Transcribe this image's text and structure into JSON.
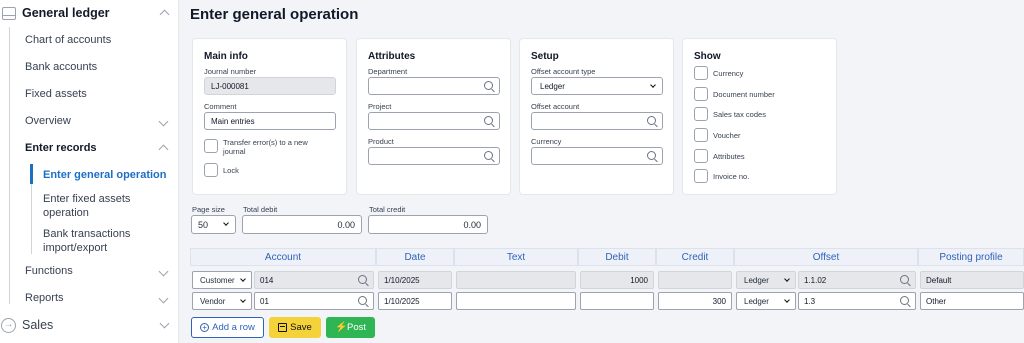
{
  "sidebar": {
    "general_ledger": "General ledger",
    "items": {
      "chart": "Chart of accounts",
      "bank": "Bank accounts",
      "fixed": "Fixed assets",
      "overview": "Overview",
      "enter_records": "Enter records",
      "functions": "Functions",
      "reports": "Reports"
    },
    "sub": {
      "general_op": "Enter general operation",
      "fixed_assets_op": "Enter fixed assets operation",
      "bank_tx": "Bank transactions import/export"
    },
    "sales": "Sales"
  },
  "page": {
    "title": "Enter general operation"
  },
  "main_info": {
    "title": "Main info",
    "journal_label": "Journal number",
    "journal_value": "LJ-000081",
    "comment_label": "Comment",
    "comment_value": "Main entries",
    "transfer_label": "Transfer error(s) to a new journal",
    "lock_label": "Lock"
  },
  "attributes": {
    "title": "Attributes",
    "department_label": "Department",
    "project_label": "Project",
    "product_label": "Product"
  },
  "setup": {
    "title": "Setup",
    "offset_type_label": "Offset account type",
    "offset_type_value": "Ledger",
    "offset_account_label": "Offset account",
    "currency_label": "Currency"
  },
  "show": {
    "title": "Show",
    "options": [
      "Currency",
      "Document number",
      "Sales tax codes",
      "Voucher",
      "Attributes",
      "Invoice no."
    ]
  },
  "totals": {
    "page_size_label": "Page size",
    "page_size_value": "50",
    "total_debit_label": "Total debit",
    "total_debit_value": "0.00",
    "total_credit_label": "Total credit",
    "total_credit_value": "0.00"
  },
  "grid": {
    "headers": {
      "account": "Account",
      "date": "Date",
      "text": "Text",
      "debit": "Debit",
      "credit": "Credit",
      "offset": "Offset",
      "posting_profile": "Posting profile"
    },
    "rows": [
      {
        "type": "Customer",
        "account": "014",
        "date": "1/10/2025",
        "text": "",
        "debit": "1000",
        "credit": "",
        "offset_type": "Ledger",
        "offset": "1.1.02",
        "profile": "Default"
      },
      {
        "type": "Vendor",
        "account": "01",
        "date": "1/10/2025",
        "text": "",
        "debit": "",
        "credit": "300",
        "offset_type": "Ledger",
        "offset": "1.3",
        "profile": "Other"
      }
    ]
  },
  "buttons": {
    "add_row": "Add a row",
    "save": "Save",
    "post": "Post"
  }
}
